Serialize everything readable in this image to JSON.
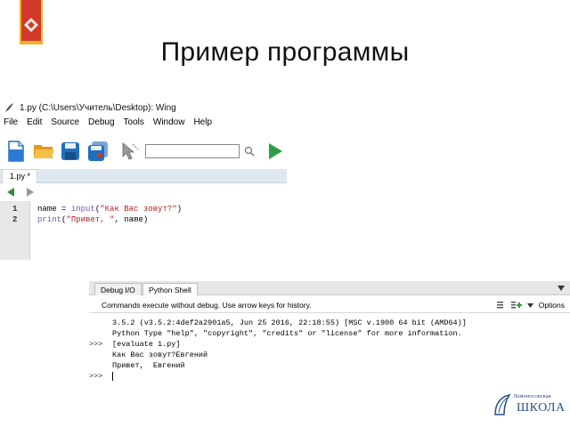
{
  "slide": {
    "title": "Пример программы"
  },
  "editor": {
    "window_title": "1.py (C:\\Users\\Учитель\\Desktop): Wing",
    "menu": [
      "File",
      "Edit",
      "Source",
      "Debug",
      "Tools",
      "Window",
      "Help"
    ],
    "toolbar_icons": [
      "new-file-icon",
      "open-folder-icon",
      "save-icon",
      "save-all-icon",
      "pointer-icon",
      "search-icon",
      "run-icon"
    ],
    "search_value": "",
    "tab_label": "1.py *",
    "line_numbers": [
      "1",
      "2"
    ],
    "code": {
      "line1": {
        "a": "name = ",
        "kw": "input",
        "b": "(",
        "str": "\"Как Вас зовут?\"",
        "c": ")"
      },
      "line2": {
        "kw": "print",
        "a": "(",
        "str": "\"Привет, \"",
        "b": ", name)"
      }
    }
  },
  "shell": {
    "tabs": [
      "Debug I/O",
      "Python Shell"
    ],
    "active_tab": "Python Shell",
    "hint": "Commands execute without debug.  Use arrow keys for history.",
    "options_label": "Options",
    "lines": [
      {
        "prompt": "",
        "text": "3.5.2 (v3.5.2:4def2a2901a5, Jun 25 2016, 22:18:55) [MSC v.1900 64 bit (AMD64)]"
      },
      {
        "prompt": "",
        "text": "Python Type \"help\", \"copyright\", \"credits\" or \"license\" for more information."
      },
      {
        "prompt": ">>>",
        "text": "[evaluate 1.py]"
      },
      {
        "prompt": "",
        "text": "Как Вас зовут?Евгений"
      },
      {
        "prompt": "",
        "text": "Привет,  Евгений"
      },
      {
        "prompt": ">>>",
        "text": ""
      }
    ]
  },
  "logo": {
    "small": "Ломоносовская",
    "big": "ШКОЛА"
  },
  "colors": {
    "ribbon_red": "#d43a2a",
    "ribbon_gold": "#e8b42a",
    "run_green": "#2ea043",
    "keyword": "#7a56b0",
    "string": "#b22222",
    "logo_blue": "#2a4f8a"
  }
}
